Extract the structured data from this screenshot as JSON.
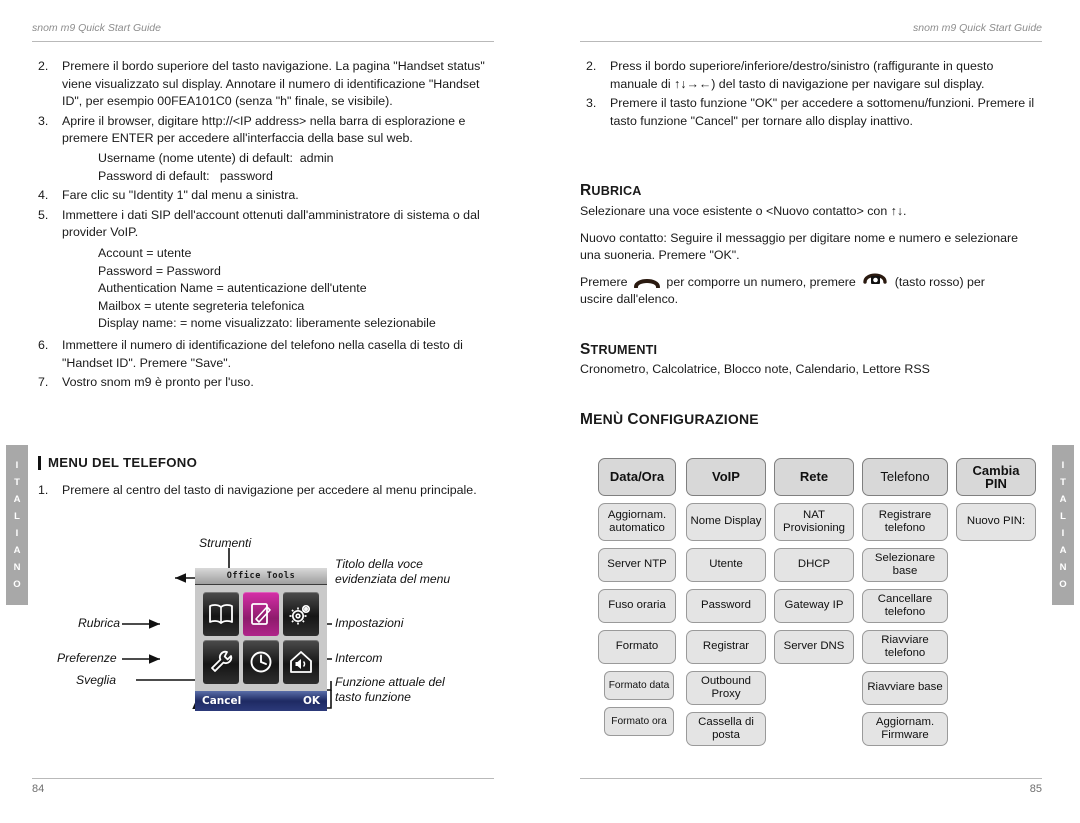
{
  "document": {
    "header_text": "snom m9 Quick Start Guide",
    "side_tab_letters": [
      "I",
      "T",
      "A",
      "L",
      "I",
      "A",
      "N",
      "O"
    ],
    "left_page_number": "84",
    "right_page_number": "85"
  },
  "left_column": {
    "steps": [
      {
        "num": "2.",
        "text": "Premere il bordo superiore del tasto navigazione. La pagina \"Handset status\" viene visualizzato sul display. Annotare il numero di identificazione \"Handset ID\", per esempio 00FEA101C0 (senza \"h\" finale, se visibile)."
      },
      {
        "num": "3.",
        "text": "Aprire il browser, digitare http://<IP address> nella barra di esplorazione e premere ENTER per accedere all'interfaccia della base sul web."
      },
      {
        "num": "4.",
        "text": "Fare clic su \"Identity 1\" dal menu a sinistra."
      },
      {
        "num": "5.",
        "text": "Immettere i dati SIP dell'account ottenuti dall'amministratore di sistema o dal provider VoIP."
      },
      {
        "num": "6.",
        "text": "Immettere il numero di identificazione del telefono nella casella di testo di \"Handset ID\".  Premere \"Save\"."
      },
      {
        "num": "7.",
        "text": "Vostro snom m9 è pronto per l'uso."
      }
    ],
    "credentials": [
      "Username (nome utente) di default:  admin",
      "Password di default:   password"
    ],
    "sip_fields": [
      "Account = utente",
      "Password = Password",
      "Authentication Name = autenticazione dell'utente",
      "Mailbox = utente segreteria telefonica",
      "Display name: = nome visualizzato: liberamente selezionabile"
    ],
    "phone_menu": {
      "heading": "MENU DEL TELEFONO",
      "step": {
        "num": "1.",
        "text": "Premere al centro del tasto di navigazione per accedere al menu principale."
      }
    },
    "diagram": {
      "callout_top": "Strumenti",
      "callout_left": [
        "Rubrica",
        "Preferenze",
        "Sveglia"
      ],
      "callout_right": [
        "Titolo della voce\nevidenziata del menu",
        "Impostazioni",
        "Intercom",
        "Funzione attuale del\ntasto funzione"
      ],
      "screen": {
        "title": "Office Tools",
        "icons": [
          {
            "name": "phonebook-icon",
            "selected": false
          },
          {
            "name": "notes-icon",
            "selected": true
          },
          {
            "name": "settings-gears-icon",
            "selected": false
          },
          {
            "name": "wrench-icon",
            "selected": false
          },
          {
            "name": "clock-icon",
            "selected": false
          },
          {
            "name": "intercom-home-icon",
            "selected": false
          }
        ],
        "softkey_left": "Cancel",
        "softkey_right": "OK"
      },
      "selected_color": "#c32a98"
    }
  },
  "right_column": {
    "steps": [
      {
        "num": "2.",
        "text": "Press il bordo superiore/inferiore/destro/sinistro (raffigurante in questo manuale di ↑↓→←) del tasto di navigazione per navigare sul display."
      },
      {
        "num": "3.",
        "text": "Premere il tasto funzione \"OK\" per accedere a sottomenu/funzioni. Premere il tasto funzione \"Cancel\" per tornare allo display inattivo."
      }
    ],
    "rubrica": {
      "heading": "Rubrica",
      "paragraphs": [
        "Selezionare una voce esistente o <Nuovo contatto> con ↑↓.",
        "Nuovo contatto:  Seguire il messaggio per digitare nome e numero e selezionare una suoneria. Premere \"OK\".",
        "Premere ⌒ per comporre un numero, premere ⌒ (tasto rosso) per uscire dall'elenco."
      ],
      "dial_line_part1": "Premere",
      "dial_line_part2": "per comporre un numero, premere",
      "dial_line_part3": "(tasto rosso) per",
      "dial_line_part4": "uscire dall'elenco."
    },
    "strumenti": {
      "heading": "Strumenti",
      "text": "Cronometro, Calcolatrice, Blocco note, Calendario, Lettore RSS"
    },
    "menu_config": {
      "heading": "Menù Configurazione",
      "columns": [
        {
          "header": "Data/Ora",
          "items": [
            "Aggiornam. automatico",
            "Server NTP",
            "Fuso oraria",
            "Formato"
          ],
          "sub_items": [
            "Formato data",
            "Formato ora"
          ]
        },
        {
          "header": "VoIP",
          "items": [
            "Nome Display",
            "Utente",
            "Password",
            "Registrar",
            "Outbound Proxy",
            "Cassella di posta"
          ],
          "sub_items": []
        },
        {
          "header": "Rete",
          "items": [
            "NAT Provisioning",
            "DHCP",
            "Gateway IP",
            "Server DNS"
          ],
          "sub_items": []
        },
        {
          "header": "Telefono",
          "items": [
            "Registrare telefono",
            "Selezionare base",
            "Cancellare telefono",
            "Riavviare telefono",
            "Riavviare base",
            "Aggiornam. Firmware"
          ],
          "sub_items": []
        },
        {
          "header": "Cambia PIN",
          "items": [
            "Nuovo PIN:"
          ],
          "sub_items": []
        }
      ]
    }
  }
}
